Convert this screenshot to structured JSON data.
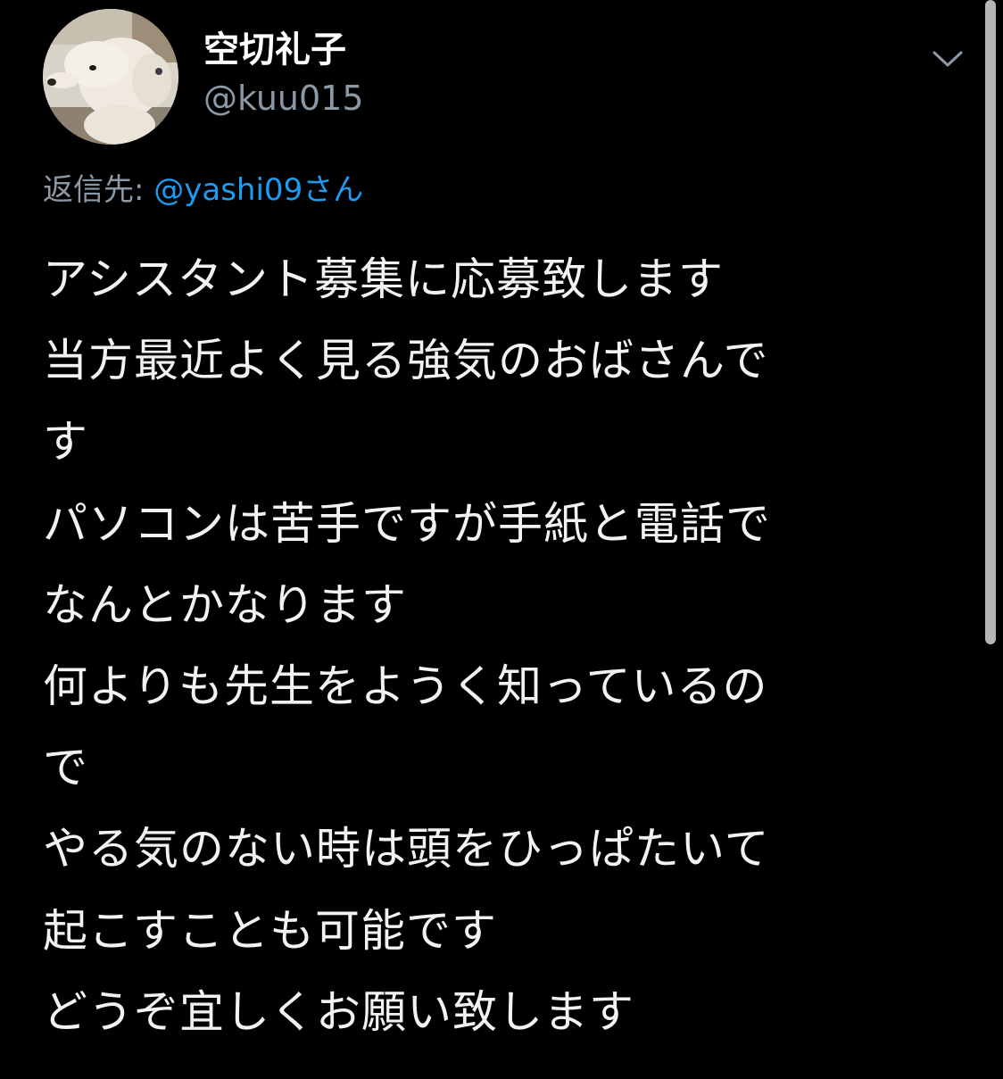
{
  "author": {
    "display_name": "空切礼子",
    "handle": "@kuu015",
    "avatar": "poodle-avatar"
  },
  "menu": {
    "icon": "chevron-down-icon"
  },
  "reply": {
    "prefix": "返信先: ",
    "handle": "@yashi09さん"
  },
  "tweet": {
    "lines": [
      "アシスタント募集に応募致します",
      "当方最近よく見る強気のおばさんで",
      "す",
      "パソコンは苦手ですが手紙と電話で",
      "なんとかなります",
      "何よりも先生をようく知っているの",
      "で",
      "やる気のない時は頭をひっぱたいて",
      "起こすことも可能です",
      "どうぞ宜しくお願い致します"
    ]
  },
  "colors": {
    "background": "#000000",
    "text": "#f2f2f2",
    "secondary": "#8b98a5",
    "link": "#1d9bf0",
    "scrollbar": "#b5b5b5"
  }
}
